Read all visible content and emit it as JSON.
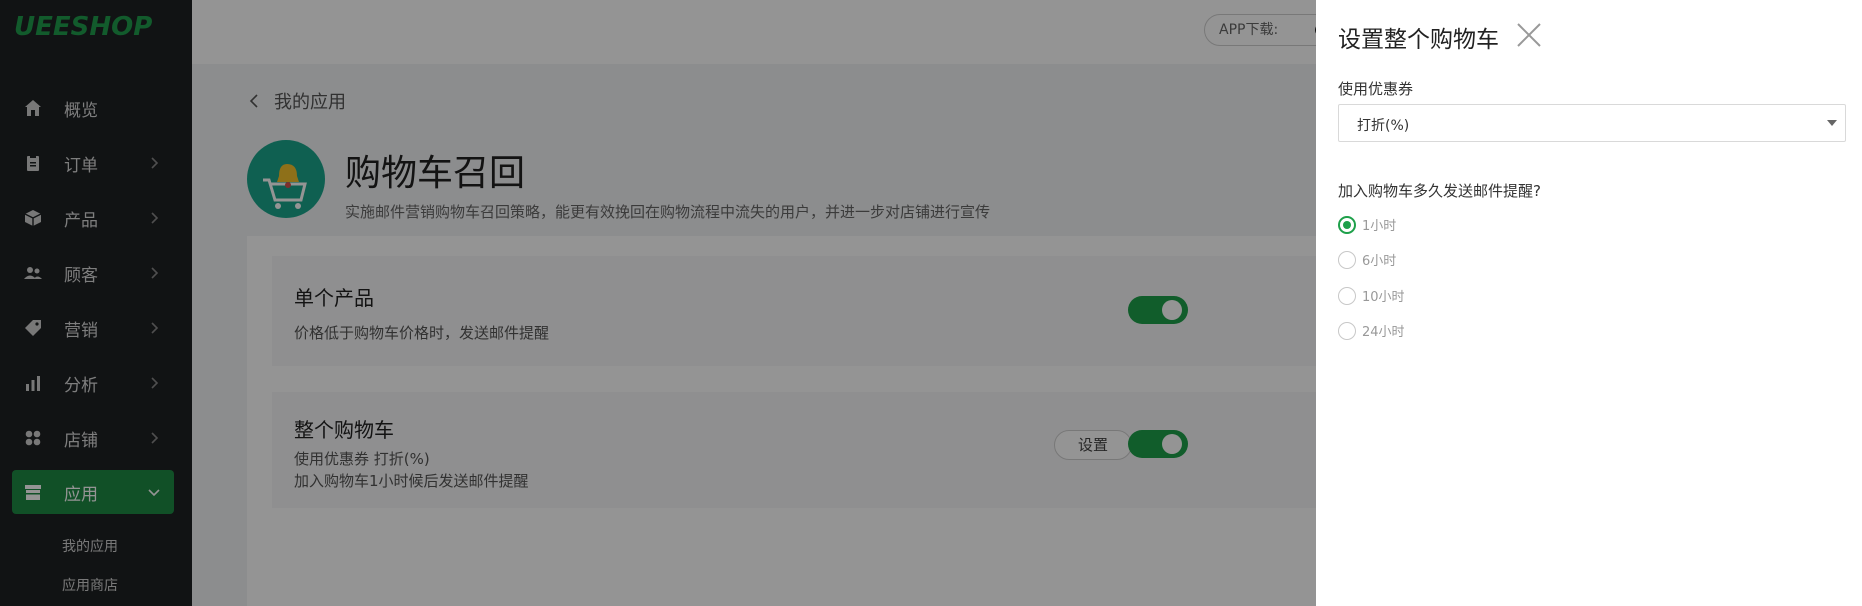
{
  "brand": {
    "logo_text": "UEESHOP",
    "accent": "#1ea04a"
  },
  "sidebar": {
    "items": [
      {
        "label": "概览",
        "icon": "home-icon"
      },
      {
        "label": "订单",
        "icon": "clipboard-icon"
      },
      {
        "label": "产品",
        "icon": "box-icon"
      },
      {
        "label": "顾客",
        "icon": "users-icon"
      },
      {
        "label": "营销",
        "icon": "tag-icon"
      },
      {
        "label": "分析",
        "icon": "bar-chart-icon"
      },
      {
        "label": "店铺",
        "icon": "grid-icon"
      },
      {
        "label": "应用",
        "icon": "store-icon"
      }
    ],
    "active_index": 7,
    "sub_items": [
      {
        "label": "我的应用"
      },
      {
        "label": "应用商店"
      }
    ]
  },
  "topbar": {
    "app_download": "APP下载:"
  },
  "main": {
    "back_label": "我的应用",
    "title": "购物车召回",
    "description": "实施邮件营销购物车召回策略，能更有效挽回在购物流程中流失的用户，并进一步对店铺进行宣传",
    "cards": [
      {
        "title": "单个产品",
        "desc1": "价格低于购物车价格时，发送邮件提醒",
        "enabled": true
      },
      {
        "title": "整个购物车",
        "desc1": "使用优惠券  打折(%)",
        "desc2": "加入购物车1小时候后发送邮件提醒",
        "button": "设置",
        "enabled": true
      }
    ]
  },
  "drawer": {
    "title": "设置整个购物车",
    "coupon_label": "使用优惠券",
    "coupon_value": "打折(%)",
    "remind_label": "加入购物车多久发送邮件提醒?",
    "options": [
      {
        "label": "1小时",
        "checked": true
      },
      {
        "label": "6小时",
        "checked": false
      },
      {
        "label": "10小时",
        "checked": false
      },
      {
        "label": "24小时",
        "checked": false
      }
    ]
  }
}
